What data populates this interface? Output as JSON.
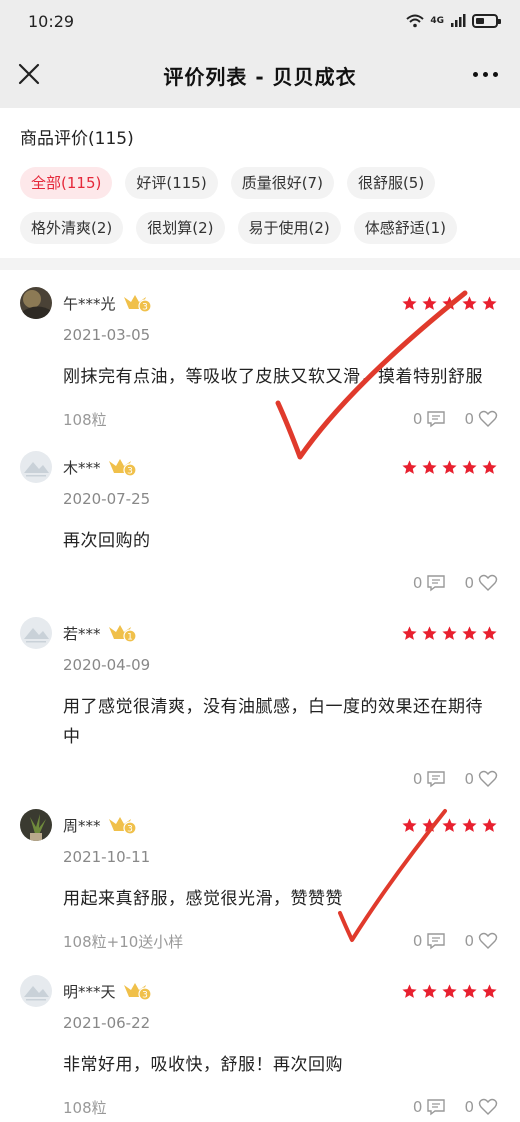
{
  "status_bar": {
    "time": "10:29",
    "network": "4G"
  },
  "nav": {
    "title": "评价列表 - 贝贝成衣"
  },
  "filter": {
    "title": "商品评价(115)",
    "tags": [
      {
        "label": "全部(115)",
        "active": true
      },
      {
        "label": "好评(115)"
      },
      {
        "label": "质量很好(7)"
      },
      {
        "label": "很舒服(5)"
      },
      {
        "label": "格外清爽(2)"
      },
      {
        "label": "很划算(2)"
      },
      {
        "label": "易于使用(2)"
      },
      {
        "label": "体感舒适(1)"
      }
    ]
  },
  "reviews": [
    {
      "user": "午***光",
      "level": "3",
      "rating": 5,
      "date": "2021-03-05",
      "content": "刚抹完有点油，等吸收了皮肤又软又滑，摸着特别舒服",
      "spec": "108粒",
      "comments": "0",
      "likes": "0"
    },
    {
      "user": "木***",
      "level": "3",
      "rating": 5,
      "date": "2020-07-25",
      "content": "再次回购的",
      "spec": "",
      "comments": "0",
      "likes": "0"
    },
    {
      "user": "若***",
      "level": "1",
      "rating": 5,
      "date": "2020-04-09",
      "content": "用了感觉很清爽，没有油腻感，白一度的效果还在期待中",
      "spec": "",
      "comments": "0",
      "likes": "0"
    },
    {
      "user": "周***",
      "level": "3",
      "rating": 5,
      "date": "2021-10-11",
      "content": "用起来真舒服，感觉很光滑，赞赞赞",
      "spec": "108粒+10送小样",
      "comments": "0",
      "likes": "0"
    },
    {
      "user": "明***天",
      "level": "3",
      "rating": 5,
      "date": "2021-06-22",
      "content": "非常好用，吸收快，舒服！再次回购",
      "spec": "108粒",
      "comments": "0",
      "likes": "0"
    }
  ],
  "colors": {
    "accent": "#e5283a",
    "star": "#e8202f",
    "annotation": "#e03a2c"
  }
}
